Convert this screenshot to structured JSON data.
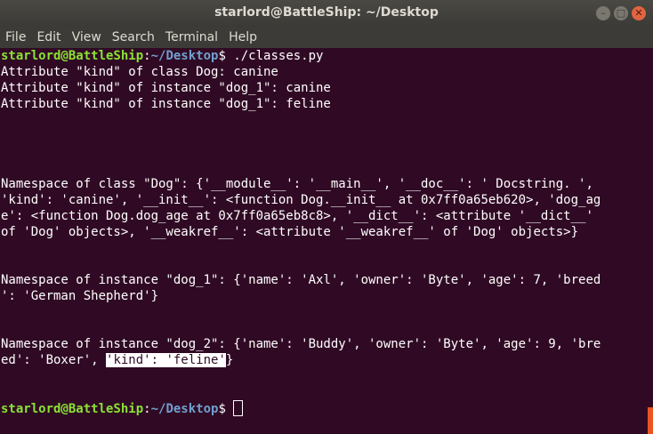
{
  "window": {
    "title": "starlord@BattleShip: ~/Desktop",
    "buttons": {
      "minimize": "–",
      "maximize": "□",
      "close": "✕"
    }
  },
  "menu": [
    "File",
    "Edit",
    "View",
    "Search",
    "Terminal",
    "Help"
  ],
  "prompt": {
    "user_host": "starlord@BattleShip",
    "colon": ":",
    "path": "~/Desktop",
    "dollar": "$ ",
    "command": "./classes.py"
  },
  "output": {
    "l1": "Attribute \"kind\" of class Dog: canine",
    "l2": "Attribute \"kind\" of instance \"dog_1\": canine",
    "l3": "Attribute \"kind\" of instance \"dog_1\": feline",
    "ns_class_1": "Namespace of class \"Dog\": {'__module__': '__main__', '__doc__': ' Docstring. ',",
    "ns_class_2": "'kind': 'canine', '__init__': <function Dog.__init__ at 0x7ff0a65eb620>, 'dog_ag",
    "ns_class_3": "e': <function Dog.dog_age at 0x7ff0a65eb8c8>, '__dict__': <attribute '__dict__'",
    "ns_class_4": "of 'Dog' objects>, '__weakref__': <attribute '__weakref__' of 'Dog' objects>}",
    "ns_dog1_1": "Namespace of instance \"dog_1\": {'name': 'Axl', 'owner': 'Byte', 'age': 7, 'breed",
    "ns_dog1_2": "': 'German Shepherd'}",
    "ns_dog2_1": "Namespace of instance \"dog_2\": {'name': 'Buddy', 'owner': 'Byte', 'age': 9, 'bre",
    "ns_dog2_2a": "ed': 'Boxer', ",
    "ns_dog2_2b": "'kind': 'feline'",
    "ns_dog2_2c": "}"
  },
  "colors": {
    "background": "#300a24",
    "user": "#8ae234",
    "path": "#729fcf",
    "scroll": "#e95420"
  }
}
